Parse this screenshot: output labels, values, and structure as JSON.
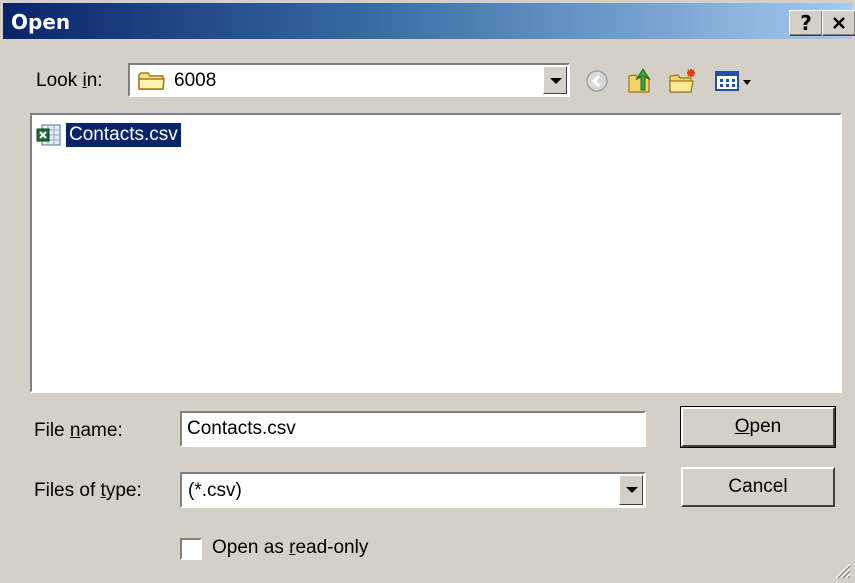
{
  "window": {
    "title": "Open",
    "help_glyph": "?",
    "close_glyph": "✕"
  },
  "lookin": {
    "label_pre": "Look ",
    "label_key": "i",
    "label_post": "n:",
    "value": "6008",
    "icon": "folder-icon"
  },
  "toolbar": {
    "back_icon": "back-arrow-icon",
    "up_icon": "up-one-level-icon",
    "new_folder_icon": "new-folder-icon",
    "views_icon": "views-menu-icon"
  },
  "files": [
    {
      "name": "Contacts.csv",
      "icon": "excel-csv-file-icon",
      "selected": true
    }
  ],
  "file_name": {
    "label_pre": "File ",
    "label_key": "n",
    "label_post": "ame:",
    "value": "Contacts.csv"
  },
  "file_type": {
    "label_pre": "Files of ",
    "label_key": "t",
    "label_post": "ype:",
    "value": "(*.csv)"
  },
  "buttons": {
    "open_key": "O",
    "open_rest": "pen",
    "cancel": "Cancel"
  },
  "readonly": {
    "label_pre": "Open as ",
    "label_key": "r",
    "label_post": "ead-only",
    "checked": false
  },
  "colors": {
    "titlebar_start": "#0a246a",
    "titlebar_end": "#a6caf0",
    "face": "#d4d0c8",
    "selection": "#0a246a"
  }
}
